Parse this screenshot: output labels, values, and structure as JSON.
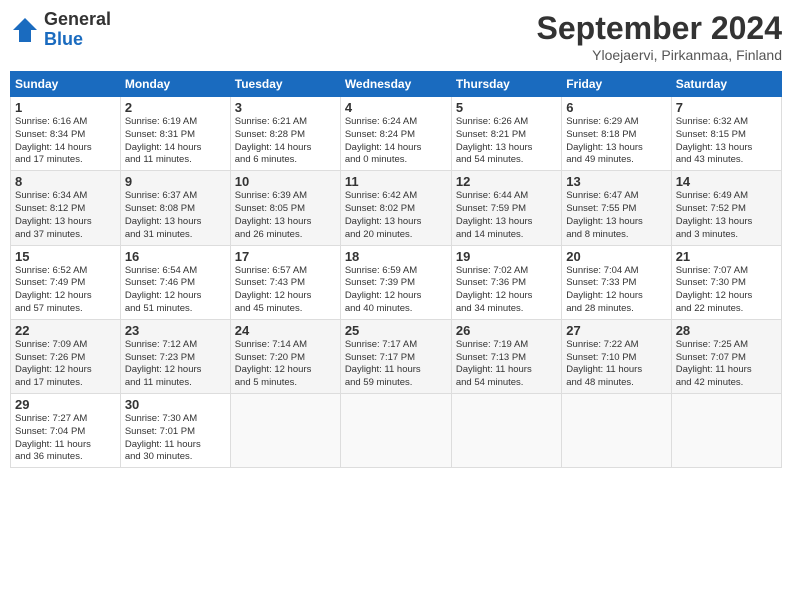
{
  "header": {
    "logo_general": "General",
    "logo_blue": "Blue",
    "title": "September 2024",
    "subtitle": "Yloejaervi, Pirkanmaa, Finland"
  },
  "calendar": {
    "days_of_week": [
      "Sunday",
      "Monday",
      "Tuesday",
      "Wednesday",
      "Thursday",
      "Friday",
      "Saturday"
    ],
    "weeks": [
      [
        {
          "day": "1",
          "info": "Sunrise: 6:16 AM\nSunset: 8:34 PM\nDaylight: 14 hours\nand 17 minutes."
        },
        {
          "day": "2",
          "info": "Sunrise: 6:19 AM\nSunset: 8:31 PM\nDaylight: 14 hours\nand 11 minutes."
        },
        {
          "day": "3",
          "info": "Sunrise: 6:21 AM\nSunset: 8:28 PM\nDaylight: 14 hours\nand 6 minutes."
        },
        {
          "day": "4",
          "info": "Sunrise: 6:24 AM\nSunset: 8:24 PM\nDaylight: 14 hours\nand 0 minutes."
        },
        {
          "day": "5",
          "info": "Sunrise: 6:26 AM\nSunset: 8:21 PM\nDaylight: 13 hours\nand 54 minutes."
        },
        {
          "day": "6",
          "info": "Sunrise: 6:29 AM\nSunset: 8:18 PM\nDaylight: 13 hours\nand 49 minutes."
        },
        {
          "day": "7",
          "info": "Sunrise: 6:32 AM\nSunset: 8:15 PM\nDaylight: 13 hours\nand 43 minutes."
        }
      ],
      [
        {
          "day": "8",
          "info": "Sunrise: 6:34 AM\nSunset: 8:12 PM\nDaylight: 13 hours\nand 37 minutes."
        },
        {
          "day": "9",
          "info": "Sunrise: 6:37 AM\nSunset: 8:08 PM\nDaylight: 13 hours\nand 31 minutes."
        },
        {
          "day": "10",
          "info": "Sunrise: 6:39 AM\nSunset: 8:05 PM\nDaylight: 13 hours\nand 26 minutes."
        },
        {
          "day": "11",
          "info": "Sunrise: 6:42 AM\nSunset: 8:02 PM\nDaylight: 13 hours\nand 20 minutes."
        },
        {
          "day": "12",
          "info": "Sunrise: 6:44 AM\nSunset: 7:59 PM\nDaylight: 13 hours\nand 14 minutes."
        },
        {
          "day": "13",
          "info": "Sunrise: 6:47 AM\nSunset: 7:55 PM\nDaylight: 13 hours\nand 8 minutes."
        },
        {
          "day": "14",
          "info": "Sunrise: 6:49 AM\nSunset: 7:52 PM\nDaylight: 13 hours\nand 3 minutes."
        }
      ],
      [
        {
          "day": "15",
          "info": "Sunrise: 6:52 AM\nSunset: 7:49 PM\nDaylight: 12 hours\nand 57 minutes."
        },
        {
          "day": "16",
          "info": "Sunrise: 6:54 AM\nSunset: 7:46 PM\nDaylight: 12 hours\nand 51 minutes."
        },
        {
          "day": "17",
          "info": "Sunrise: 6:57 AM\nSunset: 7:43 PM\nDaylight: 12 hours\nand 45 minutes."
        },
        {
          "day": "18",
          "info": "Sunrise: 6:59 AM\nSunset: 7:39 PM\nDaylight: 12 hours\nand 40 minutes."
        },
        {
          "day": "19",
          "info": "Sunrise: 7:02 AM\nSunset: 7:36 PM\nDaylight: 12 hours\nand 34 minutes."
        },
        {
          "day": "20",
          "info": "Sunrise: 7:04 AM\nSunset: 7:33 PM\nDaylight: 12 hours\nand 28 minutes."
        },
        {
          "day": "21",
          "info": "Sunrise: 7:07 AM\nSunset: 7:30 PM\nDaylight: 12 hours\nand 22 minutes."
        }
      ],
      [
        {
          "day": "22",
          "info": "Sunrise: 7:09 AM\nSunset: 7:26 PM\nDaylight: 12 hours\nand 17 minutes."
        },
        {
          "day": "23",
          "info": "Sunrise: 7:12 AM\nSunset: 7:23 PM\nDaylight: 12 hours\nand 11 minutes."
        },
        {
          "day": "24",
          "info": "Sunrise: 7:14 AM\nSunset: 7:20 PM\nDaylight: 12 hours\nand 5 minutes."
        },
        {
          "day": "25",
          "info": "Sunrise: 7:17 AM\nSunset: 7:17 PM\nDaylight: 11 hours\nand 59 minutes."
        },
        {
          "day": "26",
          "info": "Sunrise: 7:19 AM\nSunset: 7:13 PM\nDaylight: 11 hours\nand 54 minutes."
        },
        {
          "day": "27",
          "info": "Sunrise: 7:22 AM\nSunset: 7:10 PM\nDaylight: 11 hours\nand 48 minutes."
        },
        {
          "day": "28",
          "info": "Sunrise: 7:25 AM\nSunset: 7:07 PM\nDaylight: 11 hours\nand 42 minutes."
        }
      ],
      [
        {
          "day": "29",
          "info": "Sunrise: 7:27 AM\nSunset: 7:04 PM\nDaylight: 11 hours\nand 36 minutes."
        },
        {
          "day": "30",
          "info": "Sunrise: 7:30 AM\nSunset: 7:01 PM\nDaylight: 11 hours\nand 30 minutes."
        },
        {
          "day": "",
          "info": ""
        },
        {
          "day": "",
          "info": ""
        },
        {
          "day": "",
          "info": ""
        },
        {
          "day": "",
          "info": ""
        },
        {
          "day": "",
          "info": ""
        }
      ]
    ]
  }
}
